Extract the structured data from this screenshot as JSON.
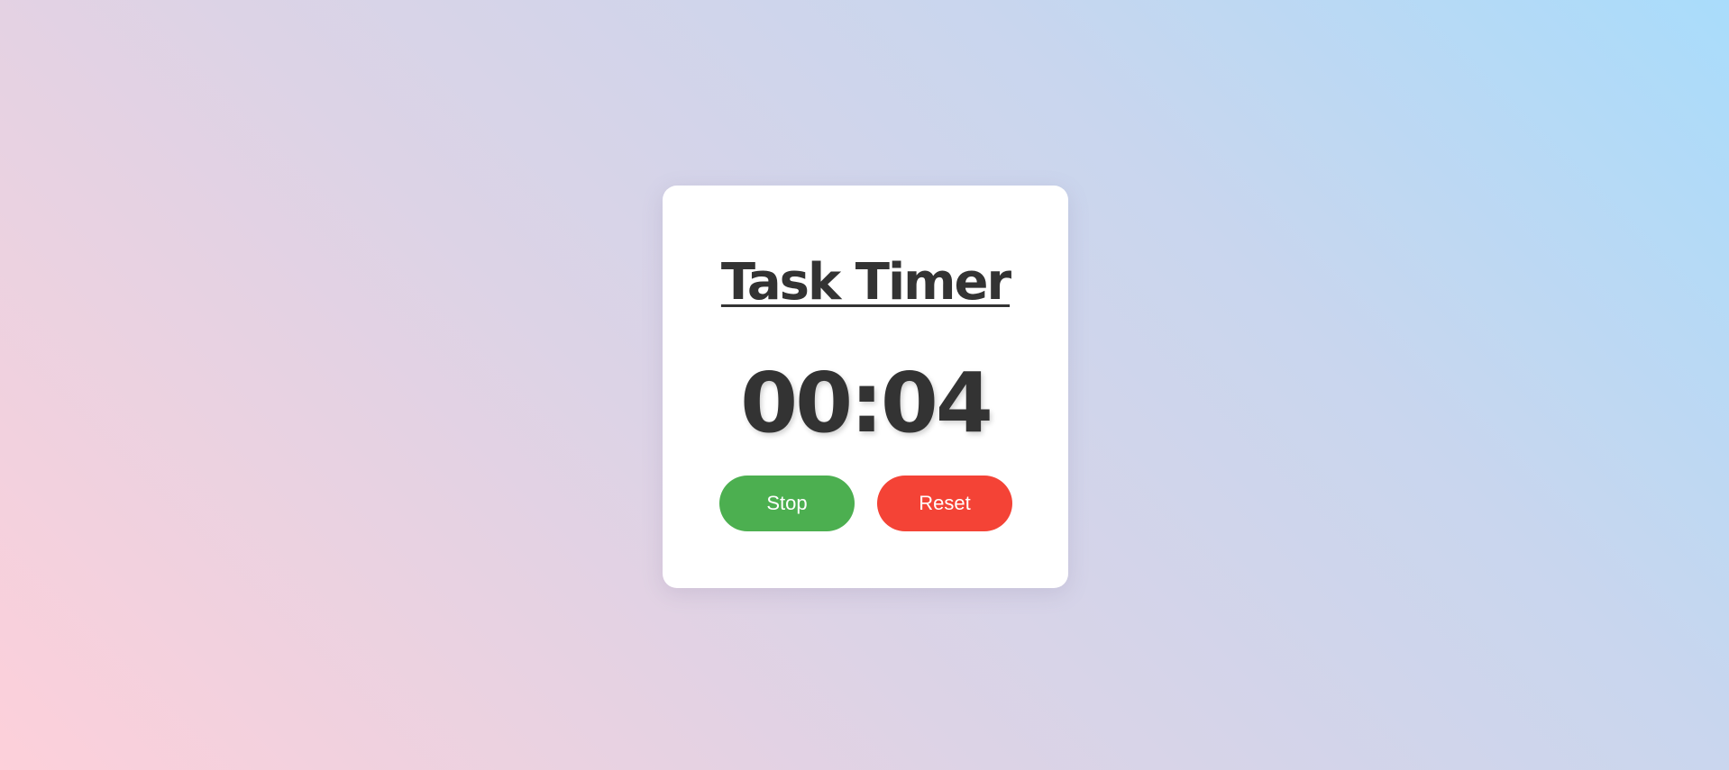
{
  "timer": {
    "title": "Task Timer",
    "display": "00:04"
  },
  "controls": {
    "stop_label": "Stop",
    "reset_label": "Reset"
  },
  "colors": {
    "stop_button": "#4caf50",
    "reset_button": "#f44336",
    "text": "#333333",
    "card": "#ffffff"
  }
}
